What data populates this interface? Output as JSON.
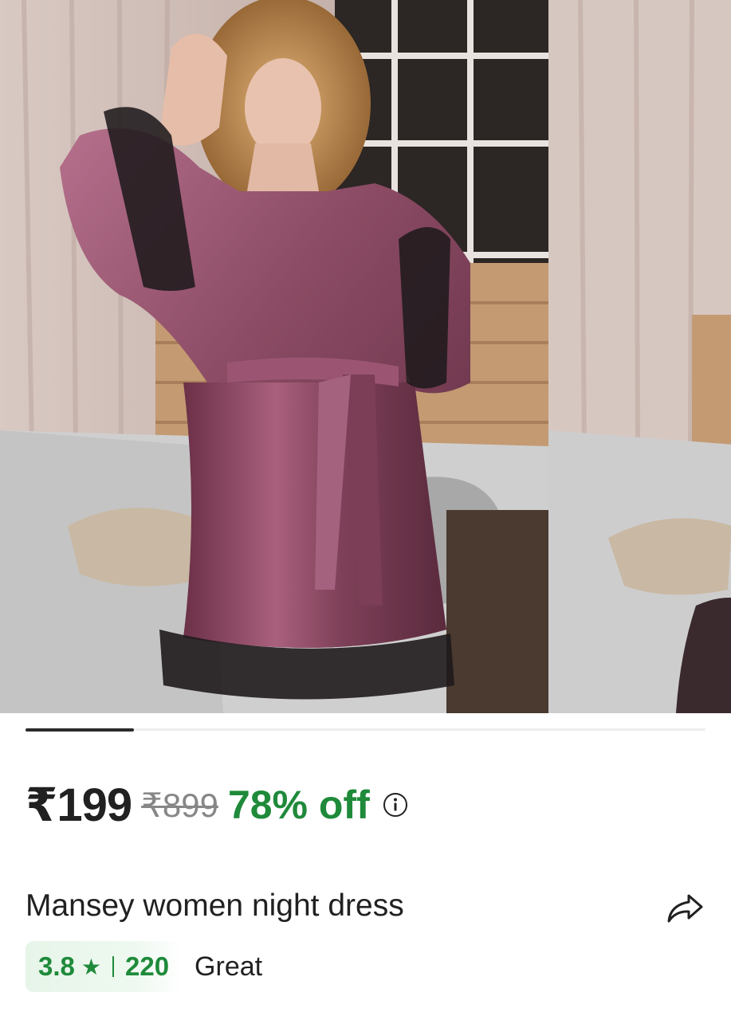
{
  "gallery": {
    "active_index": 0,
    "progress_fraction": 0.16,
    "main_image_alt": "Woman wearing mauve satin robe with black lace trim",
    "next_image_alt": "Next product image preview"
  },
  "pricing": {
    "price": "₹199",
    "mrp": "₹899",
    "discount": "78% off",
    "info_icon": "info-icon"
  },
  "product": {
    "title": "Mansey women night dress",
    "share_icon": "share-icon"
  },
  "rating": {
    "value": "3.8",
    "star": "★",
    "count": "220",
    "label": "Great"
  },
  "colors": {
    "discount_green": "#1f8a3a",
    "price_text": "#212121",
    "mrp_grey": "#878787",
    "rating_bg": "#e7f5e9",
    "robe_mauve": "#8a4a63"
  }
}
